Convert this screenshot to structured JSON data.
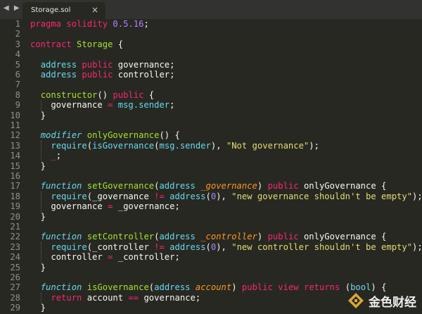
{
  "colors": {
    "keyword": "#f92672",
    "storage": "#66d9ef",
    "function_name": "#a6e22e",
    "string": "#e6db74",
    "number": "#ae81ff",
    "plain": "#f8f8f2",
    "parameter": "#fd971f",
    "line_number": "#8f908a",
    "background": "#272822"
  },
  "nav": {
    "arrows": "◀ ▶"
  },
  "tab": {
    "title": "Storage.sol",
    "close": "×"
  },
  "watermark": {
    "text": "金色财经",
    "icon": "jinse-logo-icon"
  },
  "lines": [
    {
      "n": "1",
      "t": [
        [
          "pragma solidity ",
          "k"
        ],
        [
          "0.5.16",
          "n"
        ],
        [
          ";",
          "p"
        ]
      ]
    },
    {
      "n": "2",
      "t": []
    },
    {
      "n": "3",
      "t": [
        [
          "contract",
          "k"
        ],
        [
          " ",
          "p"
        ],
        [
          "Storage",
          "f"
        ],
        [
          " {",
          "p"
        ]
      ]
    },
    {
      "n": "4",
      "t": []
    },
    {
      "n": "5",
      "t": [
        [
          "  ",
          "p"
        ],
        [
          "address",
          "s"
        ],
        [
          " ",
          "p"
        ],
        [
          "public",
          "k"
        ],
        [
          " governance;",
          "p"
        ]
      ]
    },
    {
      "n": "6",
      "t": [
        [
          "  ",
          "p"
        ],
        [
          "address",
          "s"
        ],
        [
          " ",
          "p"
        ],
        [
          "public",
          "k"
        ],
        [
          " controller;",
          "p"
        ]
      ]
    },
    {
      "n": "7",
      "t": []
    },
    {
      "n": "8",
      "t": [
        [
          "  ",
          "p"
        ],
        [
          "constructor",
          "f"
        ],
        [
          "() ",
          "p"
        ],
        [
          "public",
          "k"
        ],
        [
          " {",
          "p"
        ]
      ]
    },
    {
      "n": "9",
      "t": [
        [
          "    governance ",
          "p"
        ],
        [
          "=",
          "k"
        ],
        [
          " ",
          "p"
        ],
        [
          "msg.sender",
          "s"
        ],
        [
          ";",
          "p"
        ]
      ]
    },
    {
      "n": "10",
      "t": [
        [
          "  }",
          "p"
        ]
      ]
    },
    {
      "n": "11",
      "t": []
    },
    {
      "n": "12",
      "t": [
        [
          "  ",
          "p"
        ],
        [
          "modifier",
          "si"
        ],
        [
          " ",
          "p"
        ],
        [
          "onlyGovernance",
          "f"
        ],
        [
          "() {",
          "p"
        ]
      ]
    },
    {
      "n": "13",
      "t": [
        [
          "    ",
          "p"
        ],
        [
          "require",
          "s"
        ],
        [
          "(",
          "p"
        ],
        [
          "isGovernance",
          "s"
        ],
        [
          "(",
          "p"
        ],
        [
          "msg.sender",
          "s"
        ],
        [
          "), ",
          "p"
        ],
        [
          "\"Not governance\"",
          "str"
        ],
        [
          ");",
          "p"
        ]
      ]
    },
    {
      "n": "14",
      "t": [
        [
          "    ",
          "p"
        ],
        [
          "_",
          "k"
        ],
        [
          ";",
          "p"
        ]
      ]
    },
    {
      "n": "15",
      "t": [
        [
          "  }",
          "p"
        ]
      ]
    },
    {
      "n": "16",
      "t": []
    },
    {
      "n": "17",
      "t": [
        [
          "  ",
          "p"
        ],
        [
          "function",
          "si"
        ],
        [
          " ",
          "p"
        ],
        [
          "setGovernance",
          "f"
        ],
        [
          "(",
          "p"
        ],
        [
          "address",
          "s"
        ],
        [
          " ",
          "p"
        ],
        [
          "_governance",
          "a"
        ],
        [
          ") ",
          "p"
        ],
        [
          "public",
          "k"
        ],
        [
          " onlyGovernance {",
          "p"
        ]
      ]
    },
    {
      "n": "18",
      "t": [
        [
          "    ",
          "p"
        ],
        [
          "require",
          "s"
        ],
        [
          "(_governance ",
          "p"
        ],
        [
          "!=",
          "k"
        ],
        [
          " ",
          "p"
        ],
        [
          "address",
          "s"
        ],
        [
          "(",
          "p"
        ],
        [
          "0",
          "n"
        ],
        [
          "), ",
          "p"
        ],
        [
          "\"new governance shouldn't be empty\"",
          "str"
        ],
        [
          ");",
          "p"
        ]
      ]
    },
    {
      "n": "19",
      "t": [
        [
          "    governance ",
          "p"
        ],
        [
          "=",
          "k"
        ],
        [
          " _governance;",
          "p"
        ]
      ]
    },
    {
      "n": "20",
      "t": [
        [
          "  }",
          "p"
        ]
      ]
    },
    {
      "n": "21",
      "t": []
    },
    {
      "n": "22",
      "t": [
        [
          "  ",
          "p"
        ],
        [
          "function",
          "si"
        ],
        [
          " ",
          "p"
        ],
        [
          "setController",
          "f"
        ],
        [
          "(",
          "p"
        ],
        [
          "address",
          "s"
        ],
        [
          " ",
          "p"
        ],
        [
          "_controller",
          "a"
        ],
        [
          ") ",
          "p"
        ],
        [
          "public",
          "k"
        ],
        [
          " onlyGovernance {",
          "p"
        ]
      ]
    },
    {
      "n": "23",
      "t": [
        [
          "    ",
          "p"
        ],
        [
          "require",
          "s"
        ],
        [
          "(_controller ",
          "p"
        ],
        [
          "!=",
          "k"
        ],
        [
          " ",
          "p"
        ],
        [
          "address",
          "s"
        ],
        [
          "(",
          "p"
        ],
        [
          "0",
          "n"
        ],
        [
          "), ",
          "p"
        ],
        [
          "\"new controller shouldn't be empty\"",
          "str"
        ],
        [
          ");",
          "p"
        ]
      ]
    },
    {
      "n": "24",
      "t": [
        [
          "    controller ",
          "p"
        ],
        [
          "=",
          "k"
        ],
        [
          " _controller;",
          "p"
        ]
      ]
    },
    {
      "n": "25",
      "t": [
        [
          "  }",
          "p"
        ]
      ]
    },
    {
      "n": "26",
      "t": []
    },
    {
      "n": "27",
      "t": [
        [
          "  ",
          "p"
        ],
        [
          "function",
          "si"
        ],
        [
          " ",
          "p"
        ],
        [
          "isGovernance",
          "f"
        ],
        [
          "(",
          "p"
        ],
        [
          "address",
          "s"
        ],
        [
          " ",
          "p"
        ],
        [
          "account",
          "a"
        ],
        [
          ") ",
          "p"
        ],
        [
          "public",
          "k"
        ],
        [
          " ",
          "p"
        ],
        [
          "view",
          "k"
        ],
        [
          " ",
          "p"
        ],
        [
          "returns",
          "k"
        ],
        [
          " (",
          "p"
        ],
        [
          "bool",
          "s"
        ],
        [
          ") {",
          "p"
        ]
      ]
    },
    {
      "n": "28",
      "t": [
        [
          "    ",
          "p"
        ],
        [
          "return",
          "k"
        ],
        [
          " account ",
          "p"
        ],
        [
          "==",
          "k"
        ],
        [
          " governance;",
          "p"
        ]
      ]
    },
    {
      "n": "29",
      "t": [
        [
          "  }",
          "p"
        ]
      ]
    }
  ]
}
